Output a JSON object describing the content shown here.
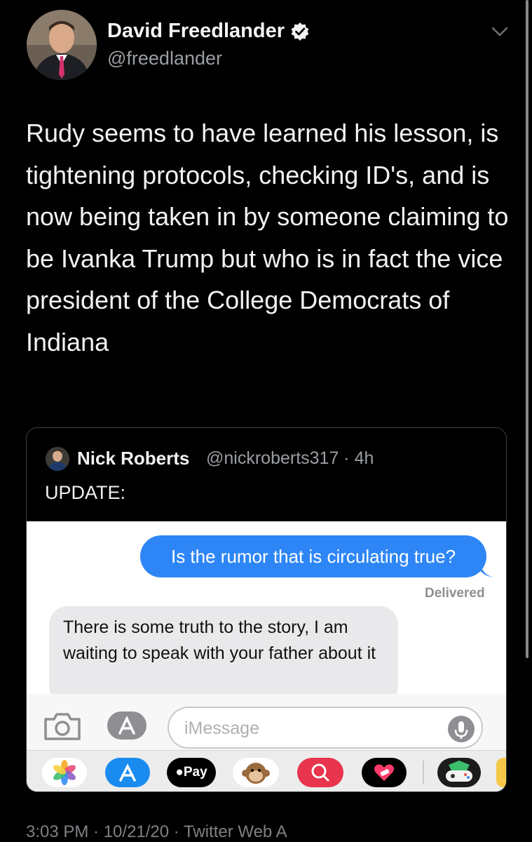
{
  "tweet": {
    "author_name": "David Freedlander",
    "author_handle": "@freedlander",
    "text": "Rudy seems to have learned his lesson, is tightening protocols, checking ID's, and is now being taken in by someone claiming to be Ivanka Trump but who is in fact the vice president of the College Democrats of Indiana"
  },
  "quoted_tweet": {
    "author_name": "Nick Roberts",
    "handle_time": "@nickroberts317 · 4h",
    "text": "UPDATE:",
    "screenshot": {
      "outgoing_message": "Is the rumor that is circulating true?",
      "status": "Delivered",
      "incoming_message": "There is some truth to the story, I am waiting to speak with your father about it",
      "input_placeholder": "iMessage",
      "apple_pay_label": "Pay"
    }
  },
  "footer_text": "3:03 PM · 10/21/20 · Twitter Web A",
  "colors": {
    "background": "#000000",
    "imessage_blue": "#2e86f6",
    "incoming_bubble": "#e9e9eb"
  },
  "icons": [
    "verified-badge-icon",
    "chevron-down-icon",
    "camera-icon",
    "app-store-icon",
    "microphone-icon",
    "photos-icon",
    "apple-pay-icon",
    "animoji-icon",
    "search-app-icon",
    "heart-app-icon",
    "game-app-icon"
  ]
}
